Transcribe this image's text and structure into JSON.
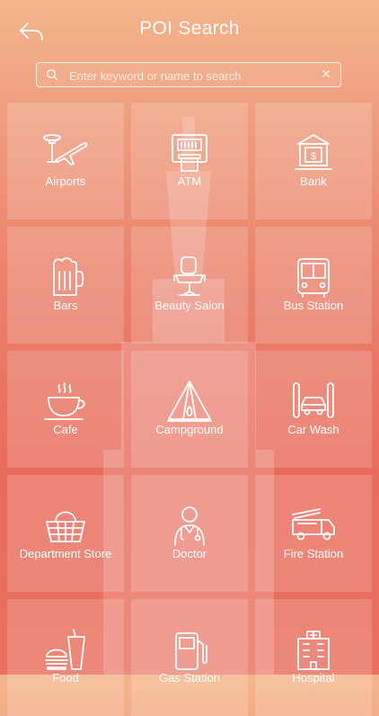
{
  "header": {
    "title": "POI Search"
  },
  "search": {
    "placeholder": "Enter keyword or name to search"
  },
  "categories": [
    {
      "label": "Airports",
      "icon": "airport-icon"
    },
    {
      "label": "ATM",
      "icon": "atm-icon"
    },
    {
      "label": "Bank",
      "icon": "bank-icon"
    },
    {
      "label": "Bars",
      "icon": "beer-mug-icon"
    },
    {
      "label": "Beauty Salon",
      "icon": "salon-chair-icon"
    },
    {
      "label": "Bus Station",
      "icon": "bus-icon"
    },
    {
      "label": "Cafe",
      "icon": "coffee-cup-icon"
    },
    {
      "label": "Campground",
      "icon": "tent-icon"
    },
    {
      "label": "Car Wash",
      "icon": "car-wash-icon"
    },
    {
      "label": "Department Store",
      "icon": "basket-icon"
    },
    {
      "label": "Doctor",
      "icon": "doctor-icon"
    },
    {
      "label": "Fire Station",
      "icon": "fire-truck-icon"
    },
    {
      "label": "Food",
      "icon": "burger-drink-icon"
    },
    {
      "label": "Gas Station",
      "icon": "gas-pump-icon"
    },
    {
      "label": "Hospital",
      "icon": "hospital-icon"
    }
  ],
  "colors": {
    "gradient_top": "#f4b58c",
    "gradient_bottom": "#e86c5c",
    "tile": "rgba(255,255,255,0.17)"
  }
}
